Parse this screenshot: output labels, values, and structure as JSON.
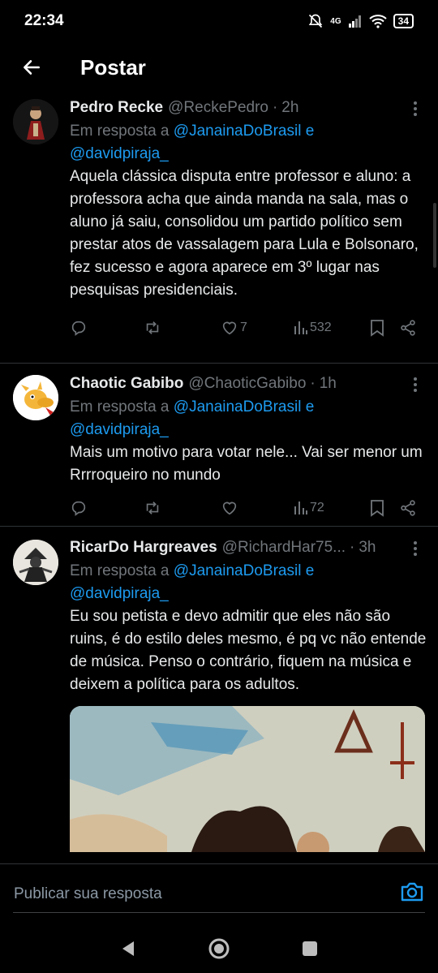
{
  "status_bar": {
    "time": "22:34",
    "network": "4G",
    "battery": "34"
  },
  "header": {
    "title": "Postar"
  },
  "tweets": [
    {
      "name": "Pedro Recke",
      "handle": "@ReckePedro",
      "dot": "·",
      "time": "2h",
      "reply_prefix": "Em resposta a ",
      "mention1": "@JanainaDoBrasil",
      "mention_joiner": " e",
      "mention2": "@davidpiraja_",
      "text": "Aquela clássica disputa entre professor e aluno: a professora acha que ainda manda na sala, mas o aluno já saiu, consolidou um partido político sem prestar atos de vassalagem para Lula e Bolsonaro, fez sucesso e agora aparece em 3º lugar nas pesquisas presidenciais.",
      "likes": "7",
      "views": "532"
    },
    {
      "name": "Chaotic Gabibo",
      "handle": "@ChaoticGabibo",
      "dot": "·",
      "time": "1h",
      "reply_prefix": "Em resposta a ",
      "mention1": "@JanainaDoBrasil",
      "mention_joiner": " e",
      "mention2": "@davidpiraja_",
      "text": "Mais um motivo para votar nele... Vai ser menor um Rrrroqueiro no mundo",
      "likes": "",
      "views": "72"
    },
    {
      "name": "RicarDo Hargreaves",
      "handle": "@RichardHar75...",
      "dot": "·",
      "time": "3h",
      "reply_prefix": "Em resposta a ",
      "mention1": "@JanainaDoBrasil",
      "mention_joiner": " e",
      "mention2": "@davidpiraja_",
      "text": "Eu sou petista e devo admitir que eles não são ruins, é do estilo deles mesmo, é pq vc não entende de música.  Penso o contrário, fiquem na música e deixem a política para os adultos."
    }
  ],
  "reply_bar": {
    "placeholder": "Publicar sua resposta"
  },
  "colors": {
    "accent": "#1d9bf0",
    "muted": "#71767b",
    "background": "#000000"
  },
  "icons": [
    "back-arrow-icon",
    "camera-icon",
    "reply-icon",
    "retweet-icon",
    "like-icon",
    "views-icon",
    "bookmark-icon",
    "share-icon",
    "more-icon",
    "mute-icon",
    "wifi-icon",
    "signal-icon",
    "battery-icon"
  ]
}
